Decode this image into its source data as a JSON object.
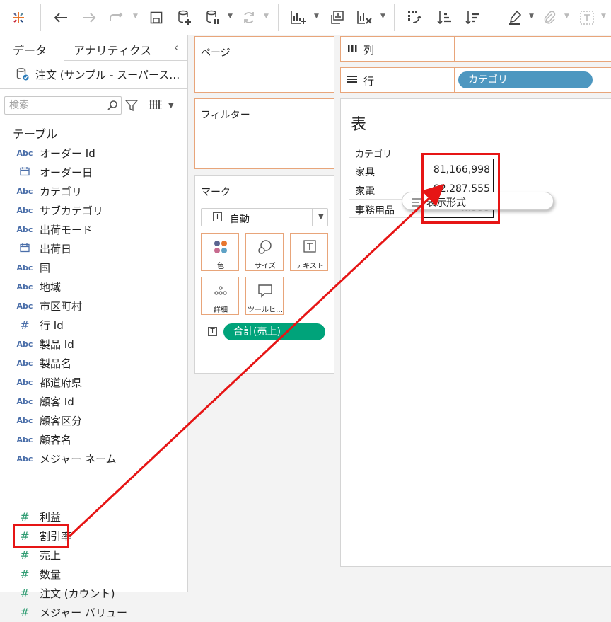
{
  "toolbar": {
    "icons": [
      "tableau-logo-icon",
      "undo-icon",
      "redo-icon",
      "replay-icon",
      "save-icon",
      "new-datasource-icon",
      "pause-updates-icon",
      "refresh-icon",
      "new-worksheet-icon",
      "duplicate-icon",
      "clear-sheet-icon",
      "swap-rows-columns-icon",
      "sort-ascending-icon",
      "sort-descending-icon",
      "highlight-icon",
      "group-icon",
      "label-icon"
    ]
  },
  "data_pane": {
    "tabs": [
      {
        "label": "データ"
      },
      {
        "label": "アナリティクス"
      }
    ],
    "datasource": "注文 (サンプル - スーパース…",
    "search_placeholder": "検索",
    "tables_heading": "テーブル",
    "dimensions": [
      {
        "type": "Abc",
        "name": "オーダー Id"
      },
      {
        "type": "date",
        "name": "オーダー日"
      },
      {
        "type": "Abc",
        "name": "カテゴリ"
      },
      {
        "type": "Abc",
        "name": "サブカテゴリ"
      },
      {
        "type": "Abc",
        "name": "出荷モード"
      },
      {
        "type": "date",
        "name": "出荷日"
      },
      {
        "type": "Abc",
        "name": "国"
      },
      {
        "type": "Abc",
        "name": "地域"
      },
      {
        "type": "Abc",
        "name": "市区町村"
      },
      {
        "type": "#",
        "name": "行 Id"
      },
      {
        "type": "Abc",
        "name": "製品 Id"
      },
      {
        "type": "Abc",
        "name": "製品名"
      },
      {
        "type": "Abc",
        "name": "都道府県"
      },
      {
        "type": "Abc",
        "name": "顧客 Id"
      },
      {
        "type": "Abc",
        "name": "顧客区分"
      },
      {
        "type": "Abc",
        "name": "顧客名"
      },
      {
        "type": "Abc",
        "name": "メジャー ネーム"
      }
    ],
    "measures": [
      {
        "type": "#",
        "name": "利益"
      },
      {
        "type": "#",
        "name": "割引率"
      },
      {
        "type": "#",
        "name": "売上"
      },
      {
        "type": "#",
        "name": "数量"
      },
      {
        "type": "#",
        "name": "注文 (カウント)"
      },
      {
        "type": "#",
        "name": "メジャー バリュー"
      }
    ]
  },
  "shelves": {
    "pages_label": "ページ",
    "filters_label": "フィルター",
    "marks_label": "マーク",
    "mark_type": "自動",
    "mark_buttons": [
      {
        "label": "色",
        "icon": "color-icon"
      },
      {
        "label": "サイズ",
        "icon": "size-icon"
      },
      {
        "label": "テキスト",
        "icon": "text-icon"
      },
      {
        "label": "詳細",
        "icon": "detail-icon"
      },
      {
        "label": "ツールヒ…",
        "icon": "tooltip-icon"
      }
    ],
    "text_pill": "合計(売上)",
    "columns_label": "列",
    "rows_label": "行",
    "rows_pill": "カテゴリ"
  },
  "view": {
    "title": "表",
    "column_header": "カテゴリ",
    "rows": [
      {
        "name": "家具",
        "value": "81,166,998"
      },
      {
        "name": "家電",
        "value": "82,287,555"
      },
      {
        "name": "事務用品",
        "value": "…999"
      }
    ],
    "drag_tooltip": "表示形式"
  },
  "colors": {
    "shelf_border": "#e8a57a",
    "dimension_pill": "#4d97c0",
    "measure_pill": "#00a37a",
    "annotation": "#e61515"
  }
}
